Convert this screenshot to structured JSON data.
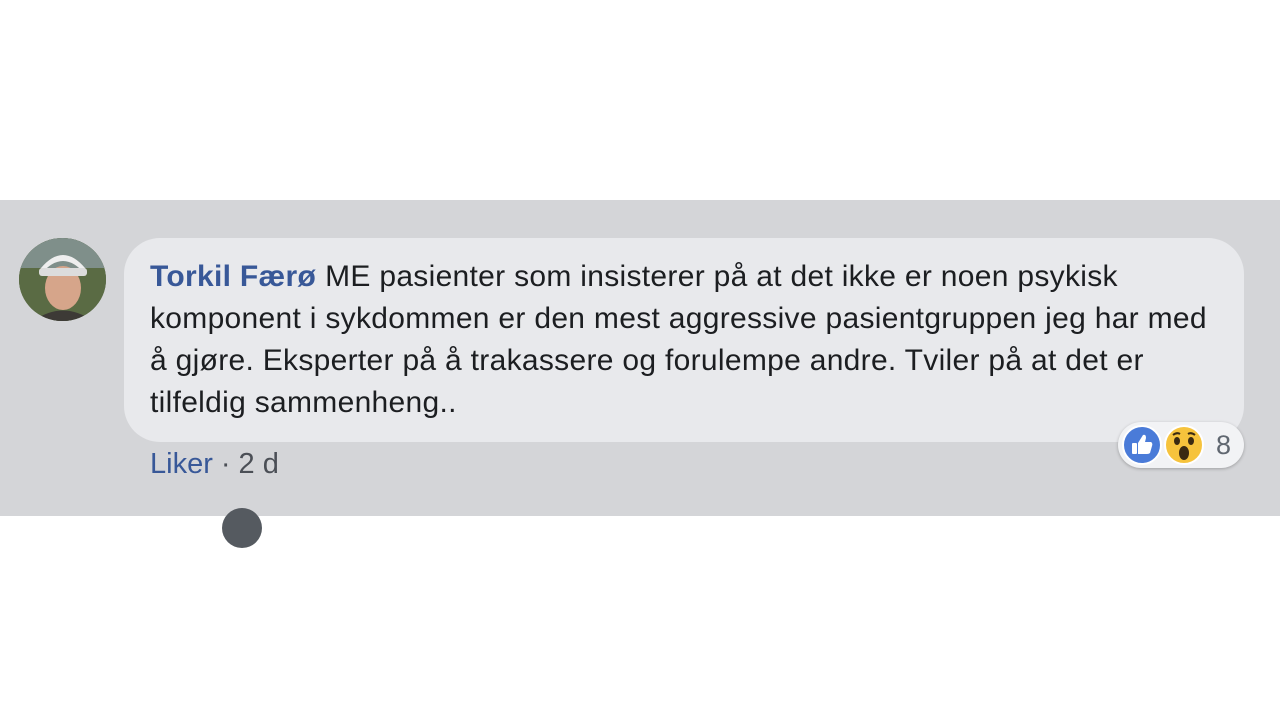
{
  "comment": {
    "author": "Torkil Færø",
    "text": "ME pasienter som insisterer på at det ikke er noen psykisk komponent i sykdommen er den mest aggressive pasientgruppen jeg har med å gjøre. Eksperter på å trakassere og forulempe andre. Tviler på at det er tilfeldig sammenheng..",
    "reactions": {
      "icons": [
        "like-icon",
        "wow-icon"
      ],
      "count": "8"
    },
    "actions": {
      "like_label": "Liker",
      "separator": "·",
      "timestamp": "2 d"
    }
  },
  "colors": {
    "background": "#d4d5d8",
    "bubble": "#e8e9ec",
    "author": "#385898",
    "like_blue": "#4a7bd8",
    "wow_yellow": "#f6c33c"
  }
}
